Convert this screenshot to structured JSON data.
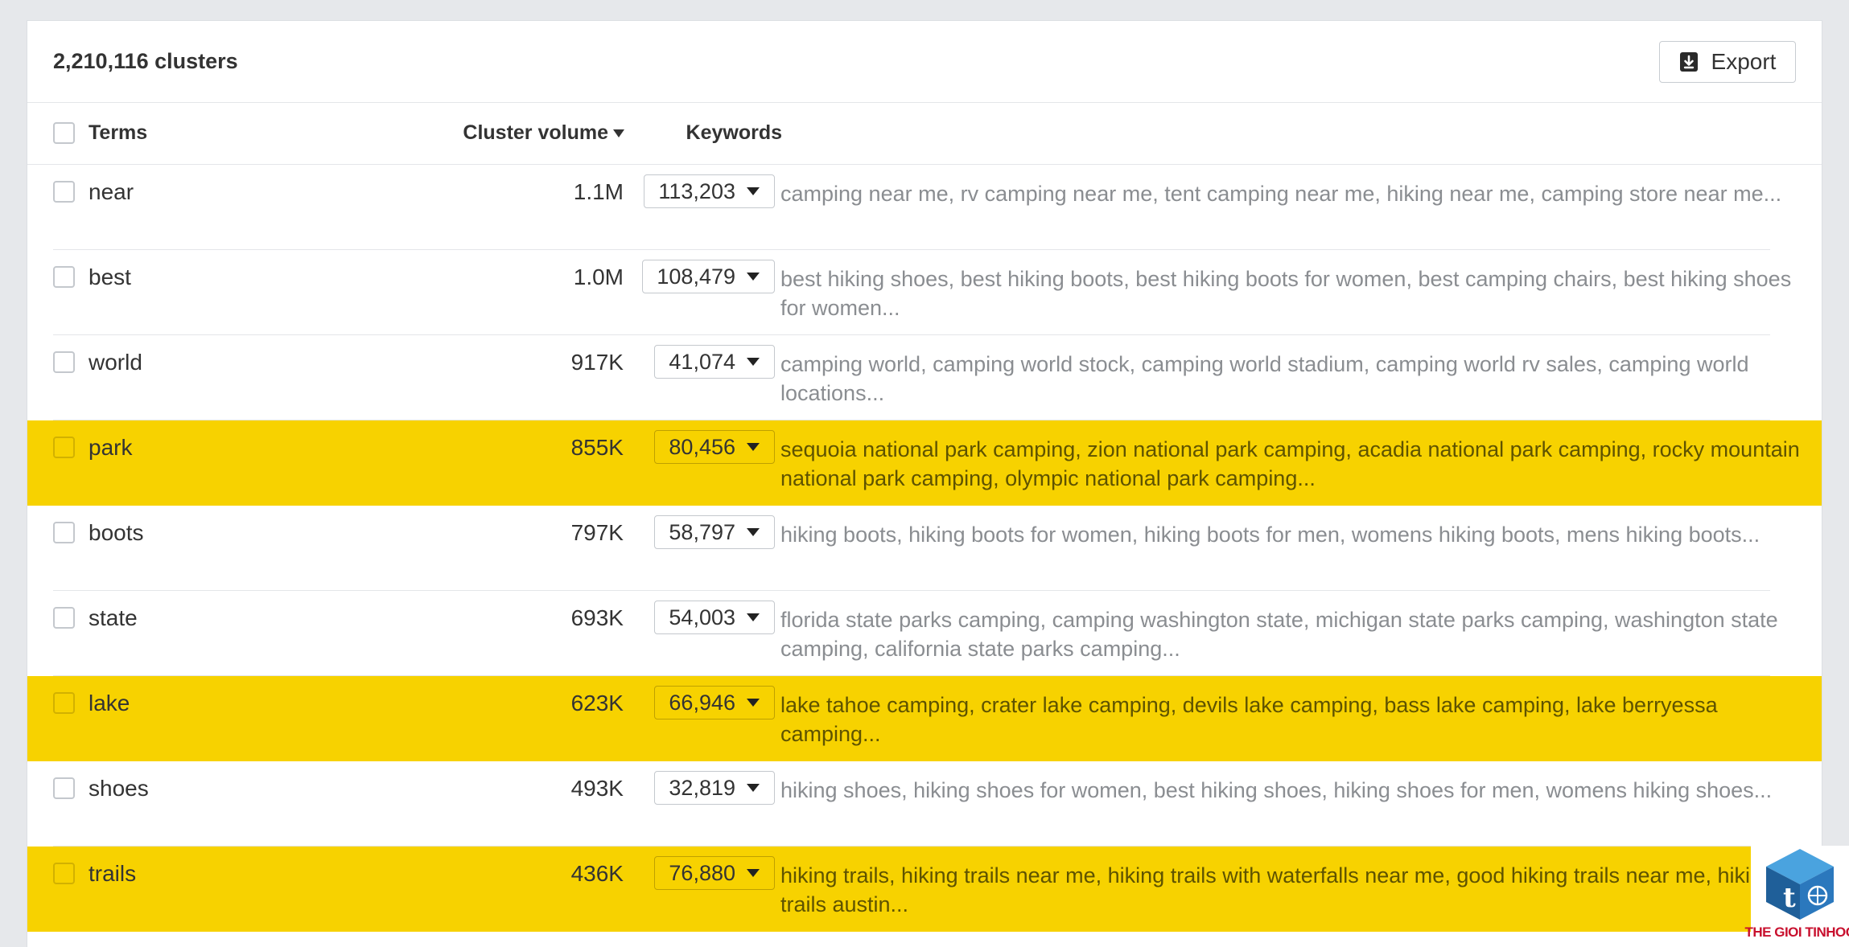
{
  "header": {
    "cluster_count": "2,210,116 clusters",
    "export_label": "Export",
    "export_icon": "download-icon"
  },
  "columns": {
    "terms": "Terms",
    "cluster_volume": "Cluster volume",
    "keywords": "Keywords"
  },
  "colors": {
    "highlight": "#f7d200",
    "secondary_text": "#8a8d91",
    "watermark_red": "#c8102e",
    "watermark_blue": "#2b6fb0"
  },
  "rows": [
    {
      "term": "near",
      "volume": "1.1M",
      "keywords_count": "113,203",
      "keywords": "camping near me, rv camping near me, tent camping near me, hiking near me, camping store near me...",
      "highlighted": false
    },
    {
      "term": "best",
      "volume": "1.0M",
      "keywords_count": "108,479",
      "keywords": "best hiking shoes, best hiking boots, best hiking boots for women, best camping chairs, best hiking shoes for women...",
      "highlighted": false
    },
    {
      "term": "world",
      "volume": "917K",
      "keywords_count": "41,074",
      "keywords": "camping world, camping world stock, camping world stadium, camping world rv sales, camping world locations...",
      "highlighted": false
    },
    {
      "term": "park",
      "volume": "855K",
      "keywords_count": "80,456",
      "keywords": "sequoia national park camping, zion national park camping, acadia national park camping, rocky mountain national park camping, olympic national park camping...",
      "highlighted": true
    },
    {
      "term": "boots",
      "volume": "797K",
      "keywords_count": "58,797",
      "keywords": "hiking boots, hiking boots for women, hiking boots for men, womens hiking boots, mens hiking boots...",
      "highlighted": false
    },
    {
      "term": "state",
      "volume": "693K",
      "keywords_count": "54,003",
      "keywords": "florida state parks camping, camping washington state, michigan state parks camping, washington state camping, california state parks camping...",
      "highlighted": false
    },
    {
      "term": "lake",
      "volume": "623K",
      "keywords_count": "66,946",
      "keywords": "lake tahoe camping, crater lake camping, devils lake camping, bass lake camping, lake berryessa camping...",
      "highlighted": true
    },
    {
      "term": "shoes",
      "volume": "493K",
      "keywords_count": "32,819",
      "keywords": "hiking shoes, hiking shoes for women, best hiking shoes, hiking shoes for men, womens hiking shoes...",
      "highlighted": false
    },
    {
      "term": "trails",
      "volume": "436K",
      "keywords_count": "76,880",
      "keywords": "hiking trails, hiking trails near me, hiking trails with waterfalls near me, good hiking trails near me, hiking trails austin...",
      "highlighted": true
    }
  ],
  "watermark": {
    "text": "THE GIOI TINHOC"
  }
}
